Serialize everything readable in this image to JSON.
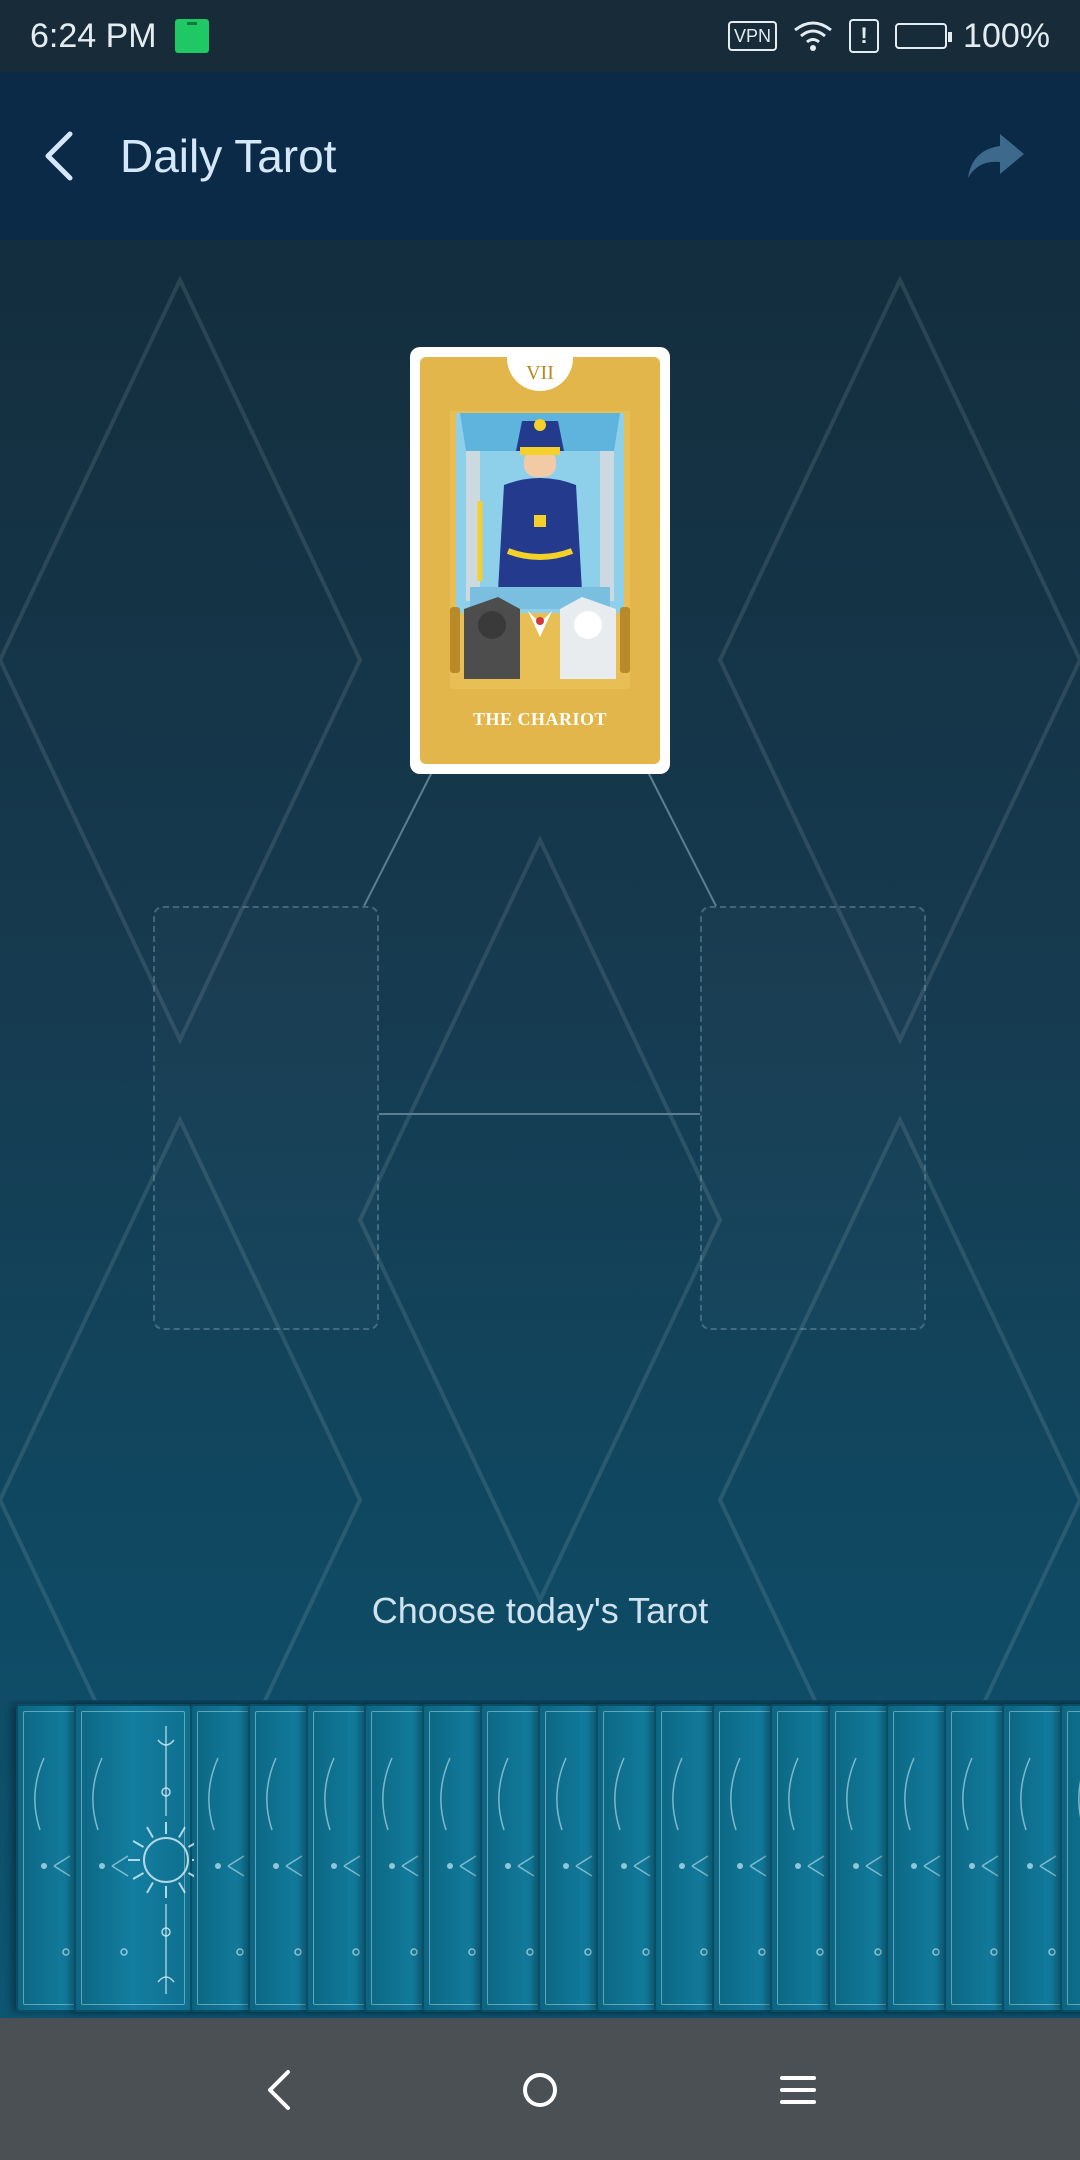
{
  "status_bar": {
    "time": "6:24 PM",
    "vpn_label": "VPN",
    "alert_label": "!",
    "battery_percent": "100%",
    "battery_level": 1.0
  },
  "toolbar": {
    "title": "Daily Tarot",
    "back_icon": "back-arrow-icon",
    "share_icon": "share-icon"
  },
  "drawn_card": {
    "numeral": "VII",
    "name": "THE CHARIOT"
  },
  "prompt": "Choose today's Tarot",
  "deck": {
    "card_count": 19
  },
  "colors": {
    "toolbar_bg": "#0b2a48",
    "card_gold": "#e2b64a",
    "deck_teal": "#137ea0",
    "nav_bar_bg": "#4b5055"
  },
  "nav_bar": {
    "back_icon": "nav-back-icon",
    "home_icon": "nav-home-icon",
    "menu_icon": "nav-menu-icon"
  }
}
